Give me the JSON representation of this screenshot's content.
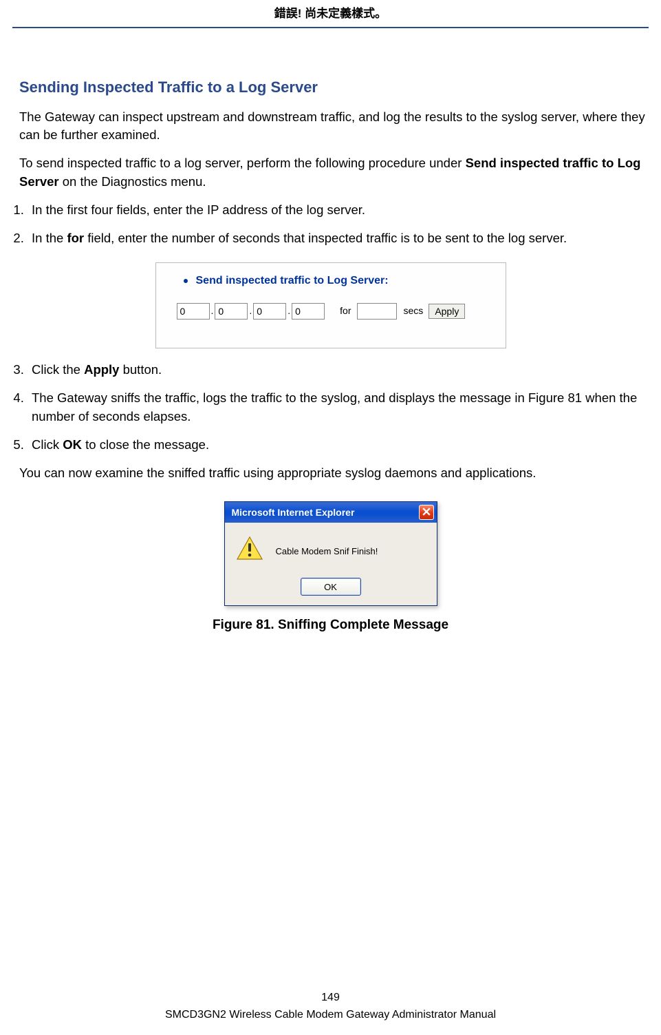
{
  "header": {
    "text": "錯誤! 尚未定義樣式。"
  },
  "section": {
    "heading": "Sending Inspected Traffic to a Log Server",
    "p1": "The Gateway can inspect upstream and downstream traffic, and log the results to the syslog server, where they can be further examined.",
    "p2a": "To send inspected traffic to a log server, perform the following procedure under ",
    "p2b": "Send inspected traffic to Log Server",
    "p2c": " on the Diagnostics menu."
  },
  "steps": {
    "s1": "In the first four fields, enter the IP address of the log server.",
    "s2a": "In the ",
    "s2b": "for",
    "s2c": " field, enter the number of seconds that inspected traffic is to be sent to the log server.",
    "s3a": "Click the ",
    "s3b": "Apply",
    "s3c": " button.",
    "s4": "The Gateway sniffs the traffic, logs the traffic to the syslog, and displays the message in Figure 81 when the number of seconds elapses.",
    "s5a": "Click ",
    "s5b": "OK",
    "s5c": " to close the message."
  },
  "postnote": "You can now examine the sniffed traffic using appropriate syslog daemons and applications.",
  "fig1": {
    "title": "Send inspected traffic to Log Server:",
    "ip": [
      "0",
      "0",
      "0",
      "0"
    ],
    "for_label": "for",
    "secs_value": "",
    "secs_label": "secs",
    "apply_label": "Apply"
  },
  "dialog": {
    "title": "Microsoft Internet Explorer",
    "message": "Cable Modem Snif Finish!",
    "ok_label": "OK"
  },
  "figure_caption": "Figure 81. Sniffing Complete Message",
  "footer": {
    "page": "149",
    "book": "SMCD3GN2 Wireless Cable Modem Gateway Administrator Manual"
  }
}
